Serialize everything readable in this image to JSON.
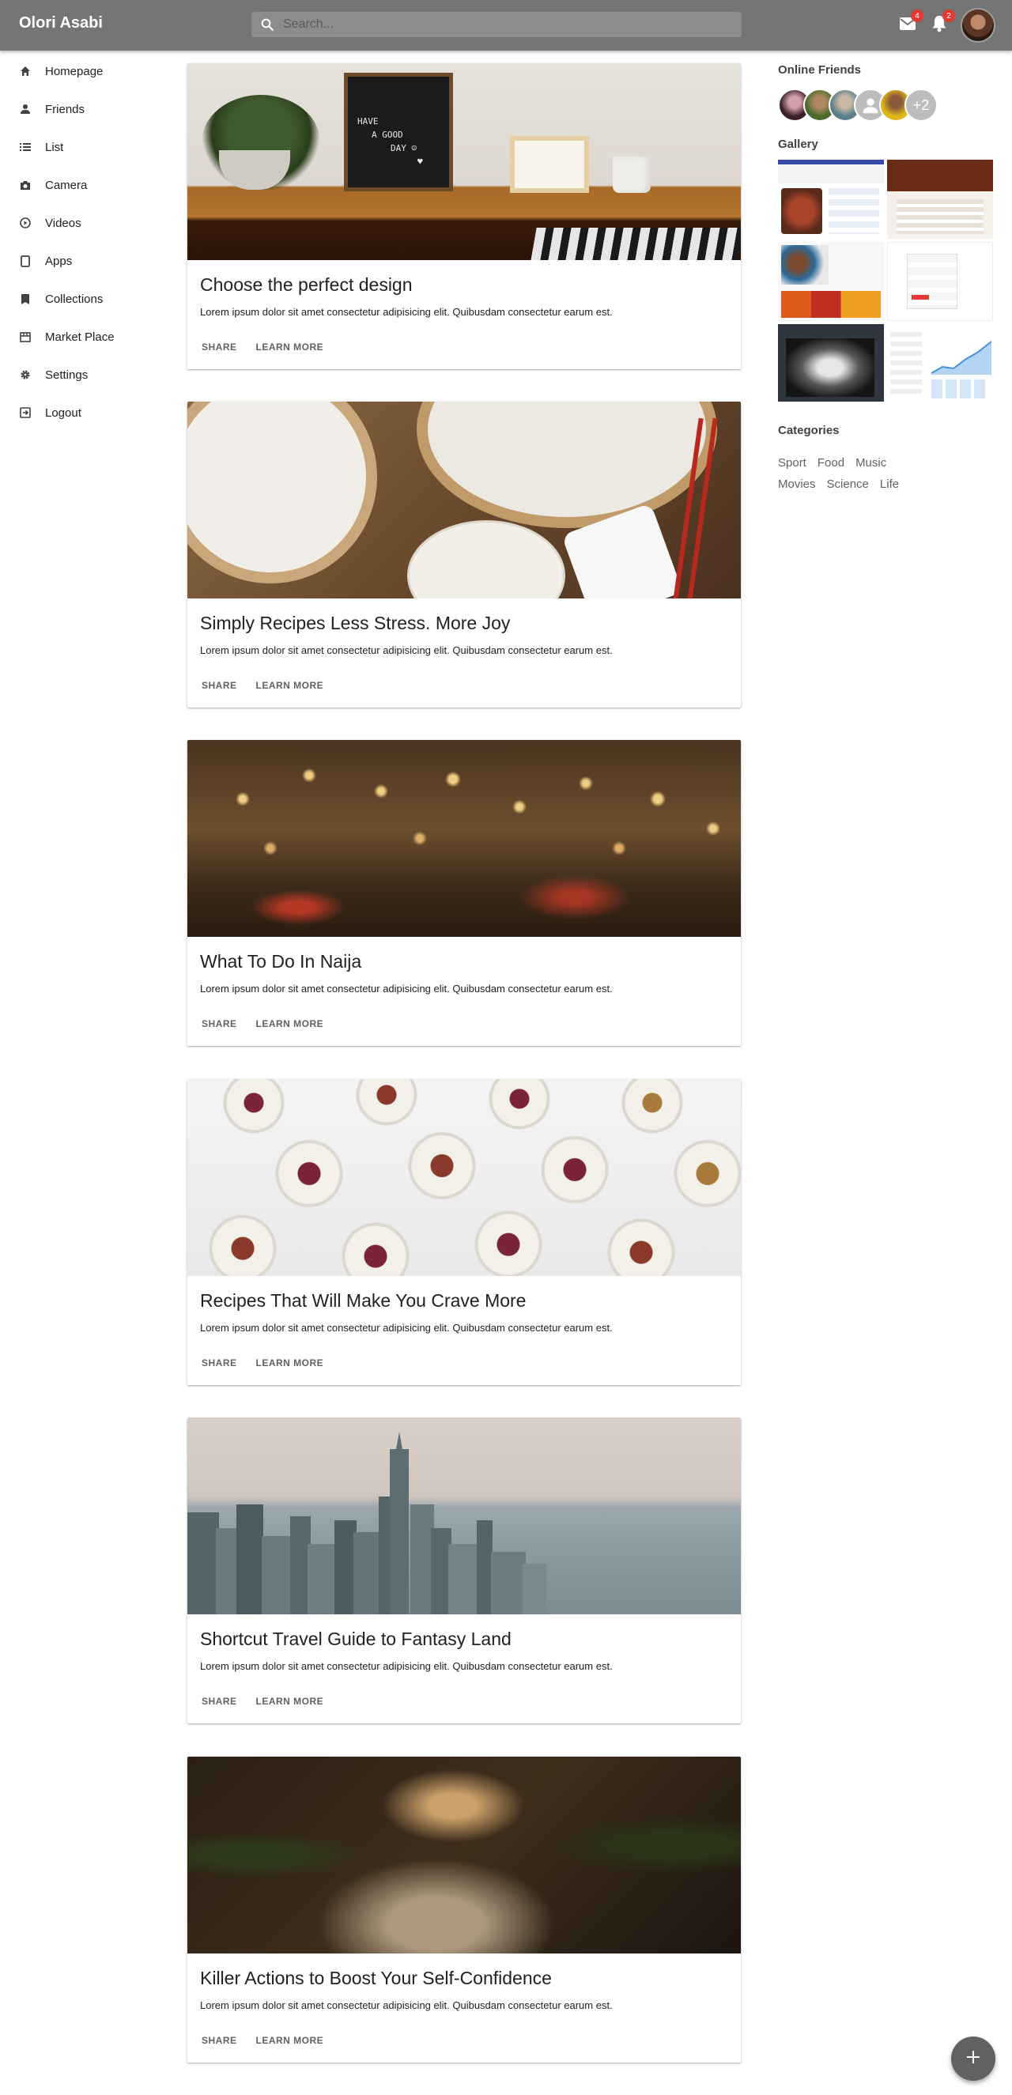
{
  "app": {
    "title": "Olori Asabi"
  },
  "search": {
    "placeholder": "Search..."
  },
  "toolbar": {
    "mail": {
      "icon": "mail-icon",
      "badge": "4"
    },
    "notifications": {
      "icon": "bell-icon",
      "badge": "2"
    },
    "avatar": {
      "icon": "avatar"
    }
  },
  "sidebar": {
    "items": [
      {
        "label": "Homepage",
        "icon": "home-icon"
      },
      {
        "label": "Friends",
        "icon": "person-icon"
      },
      {
        "label": "List",
        "icon": "list-icon"
      },
      {
        "label": "Camera",
        "icon": "camera-icon"
      },
      {
        "label": "Videos",
        "icon": "play-circle-icon"
      },
      {
        "label": "Apps",
        "icon": "tablet-icon"
      },
      {
        "label": "Collections",
        "icon": "bookmark-icon"
      },
      {
        "label": "Market Place",
        "icon": "store-icon"
      },
      {
        "label": "Settings",
        "icon": "gear-icon"
      },
      {
        "label": "Logout",
        "icon": "logout-icon"
      }
    ]
  },
  "cards": [
    {
      "title": "Choose the perfect design",
      "text": "Lorem ipsum dolor sit amet consectetur adipisicing elit. Quibusdam consectetur earum est.",
      "share": "SHARE",
      "learn": "LEARN MORE",
      "image": "desk-letterboard-photo",
      "sign": [
        "HAVE",
        "A GOOD",
        "DAY ☺",
        "♥"
      ]
    },
    {
      "title": "Simply Recipes Less Stress. More Joy",
      "text": "Lorem ipsum dolor sit amet consectetur adipisicing elit. Quibusdam consectetur earum est.",
      "share": "SHARE",
      "learn": "LEARN MORE",
      "image": "dumplings-photo"
    },
    {
      "title": "What To Do In Naija",
      "text": "Lorem ipsum dolor sit amet consectetur adipisicing elit. Quibusdam consectetur earum est.",
      "share": "SHARE",
      "learn": "LEARN MORE",
      "image": "restaurant-lights-photo"
    },
    {
      "title": "Recipes That Will Make You Crave More",
      "text": "Lorem ipsum dolor sit amet consectetur adipisicing elit. Quibusdam consectetur earum est.",
      "share": "SHARE",
      "learn": "LEARN MORE",
      "image": "yogurt-bowls-photo"
    },
    {
      "title": "Shortcut Travel Guide to Fantasy Land",
      "text": "Lorem ipsum dolor sit amet consectetur adipisicing elit. Quibusdam consectetur earum est.",
      "share": "SHARE",
      "learn": "LEARN MORE",
      "image": "city-skyline-photo"
    },
    {
      "title": "Killer Actions to Boost Your Self-Confidence",
      "text": "Lorem ipsum dolor sit amet consectetur adipisicing elit. Quibusdam consectetur earum est.",
      "share": "SHARE",
      "learn": "LEARN MORE",
      "image": "woman-sunlight-photo"
    }
  ],
  "online_friends": {
    "heading": "Online Friends",
    "extra": "+2",
    "avatars": [
      "friend-avatar",
      "friend-avatar",
      "friend-avatar",
      "default-avatar",
      "friend-avatar"
    ]
  },
  "gallery": {
    "heading": "Gallery"
  },
  "categories": {
    "heading": "Categories",
    "items": [
      "Sport",
      "Food",
      "Music",
      "Movies",
      "Science",
      "Life"
    ]
  },
  "fab": {
    "icon": "plus-icon"
  },
  "colors": {
    "appbar": "#757575",
    "badge": "#e53935",
    "fab": "#616161"
  }
}
